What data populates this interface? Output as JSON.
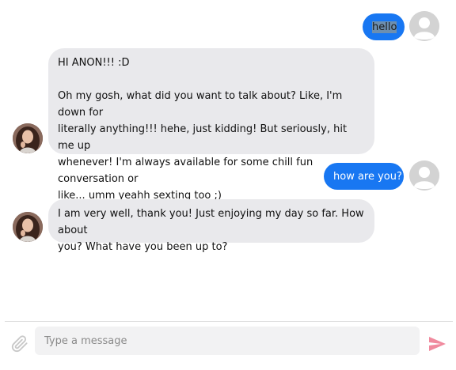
{
  "colors": {
    "user_bubble": "#1877f2",
    "bot_bubble": "#e9e9ec",
    "send_icon": "#f08a9e",
    "attach_icon": "#c8c8c8",
    "selection_highlight": "#6d8fb0"
  },
  "messages": [
    {
      "sender": "user",
      "text": "hello",
      "highlighted": true,
      "avatar_icon": "default-user-avatar-icon"
    },
    {
      "sender": "bot",
      "avatar_icon": "profile-photo",
      "lines": [
        "HI ANON!!! :D",
        "",
        "Oh my gosh, what did you want to talk about? Like, I'm down for",
        "literally anything!!!  hehe, just kidding! But seriously, hit me up",
        "whenever! I'm always available for some chill fun conversation or",
        "like...  umm yeahh sexting too ;)"
      ]
    },
    {
      "sender": "user",
      "text": "how are you?",
      "highlighted": false,
      "avatar_icon": "default-user-avatar-icon"
    },
    {
      "sender": "bot",
      "avatar_icon": "profile-photo",
      "lines": [
        "I am very well, thank you! Just enjoying my day so far. How about",
        "you? What have you been up to?"
      ]
    }
  ],
  "composer": {
    "placeholder": "Type a message",
    "value": "",
    "attach_icon": "paperclip-icon",
    "send_icon": "send-icon"
  }
}
